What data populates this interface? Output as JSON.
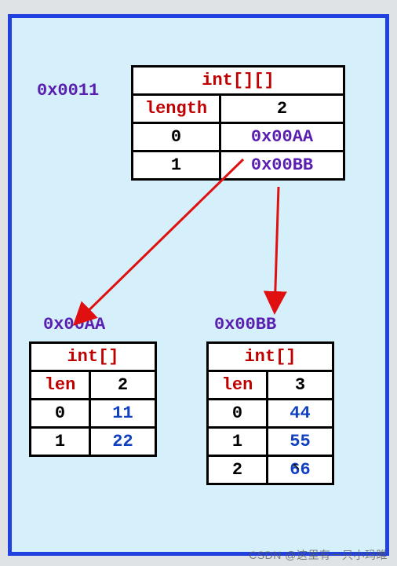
{
  "outer": {
    "address": "0x0011",
    "type": "int[][]",
    "length_label": "length",
    "length_value": "2",
    "rows": [
      {
        "index": "0",
        "value": "0x00AA"
      },
      {
        "index": "1",
        "value": "0x00BB"
      }
    ]
  },
  "childA": {
    "address": "0x00AA",
    "type": "int[]",
    "length_label": "len",
    "length_value": "2",
    "rows": [
      {
        "index": "0",
        "value": "11"
      },
      {
        "index": "1",
        "value": "22"
      }
    ]
  },
  "childB": {
    "address": "0x00BB",
    "type": "int[]",
    "length_label": "len",
    "length_value": "3",
    "rows": [
      {
        "index": "0",
        "value": "44"
      },
      {
        "index": "1",
        "value": "55"
      },
      {
        "index": "2",
        "value": "66"
      }
    ]
  },
  "watermark": "CSDN @这里有一只小玛睢"
}
